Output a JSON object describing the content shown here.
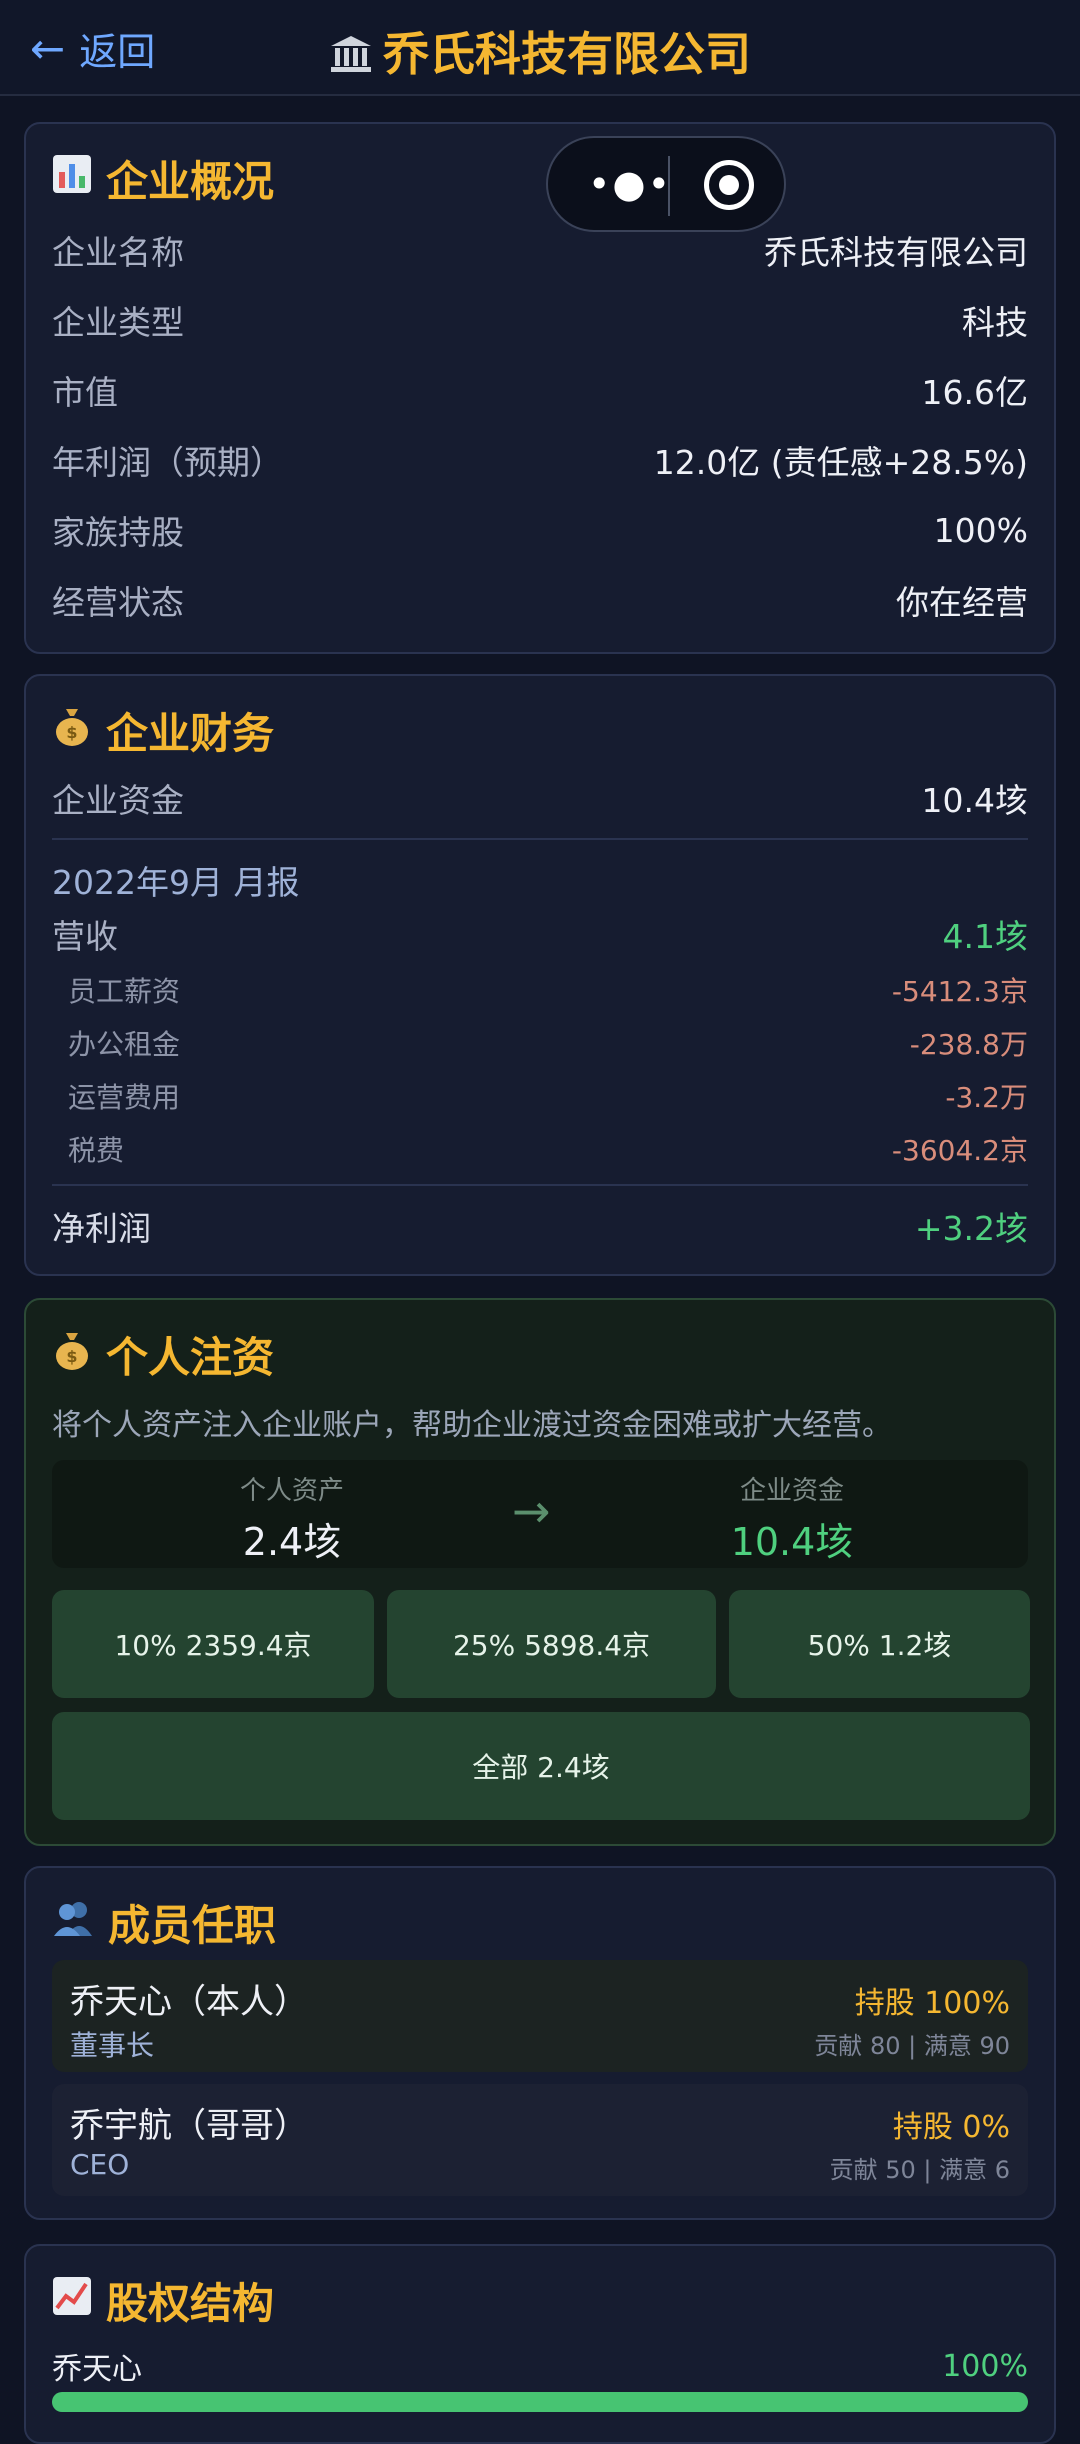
{
  "header": {
    "back_label": "返回",
    "title": "乔氏科技有限公司"
  },
  "overview": {
    "title": "企业概况",
    "rows": [
      {
        "label": "企业名称",
        "value": "乔氏科技有限公司"
      },
      {
        "label": "企业类型",
        "value": "科技"
      },
      {
        "label": "市值",
        "value": "16.6亿"
      },
      {
        "label": "年利润（预期）",
        "value": "12.0亿 (责任感+28.5%)"
      },
      {
        "label": "家族持股",
        "value": "100%"
      },
      {
        "label": "经营状态",
        "value": "你在经营"
      }
    ]
  },
  "finance": {
    "title": "企业财务",
    "capital_label": "企业资金",
    "capital_value": "10.4垓",
    "report_title": "2022年9月 月报",
    "revenue_label": "营收",
    "revenue_value": "4.1垓",
    "expenses": [
      {
        "label": "员工薪资",
        "value": "-5412.3京"
      },
      {
        "label": "办公租金",
        "value": "-238.8万"
      },
      {
        "label": "运营费用",
        "value": "-3.2万"
      },
      {
        "label": "税费",
        "value": "-3604.2京"
      }
    ],
    "net_label": "净利润",
    "net_value": "+3.2垓"
  },
  "inject": {
    "title": "个人注资",
    "description": "将个人资产注入企业账户，帮助企业渡过资金困难或扩大经营。",
    "personal_label": "个人资产",
    "personal_value": "2.4垓",
    "company_label": "企业资金",
    "company_value": "10.4垓",
    "buttons": [
      "10% 2359.4京",
      "25% 5898.4京",
      "50% 1.2垓"
    ],
    "all_button": "全部 2.4垓"
  },
  "members": {
    "title": "成员任职",
    "list": [
      {
        "name": "乔天心（本人）",
        "role": "董事长",
        "share": "持股 100%",
        "stat": "贡献 80 | 满意 90"
      },
      {
        "name": "乔宇航（哥哥）",
        "role": "CEO",
        "share": "持股 0%",
        "stat": "贡献 50 | 满意 6"
      }
    ]
  },
  "equity": {
    "title": "股权结构",
    "holders": [
      {
        "name": "乔天心",
        "percent": "100%",
        "fraction": 1.0
      }
    ]
  },
  "colors": {
    "accent": "#f5b731",
    "positive": "#4fd07f",
    "negative": "#d98d7b",
    "link": "#6fa8ff"
  },
  "icons": {
    "back": "left-arrow-icon",
    "title": "bank-icon",
    "overview": "bar-chart-icon",
    "finance": "money-bag-icon",
    "inject": "money-bag-icon",
    "members": "people-icon",
    "equity": "trend-chart-icon"
  }
}
